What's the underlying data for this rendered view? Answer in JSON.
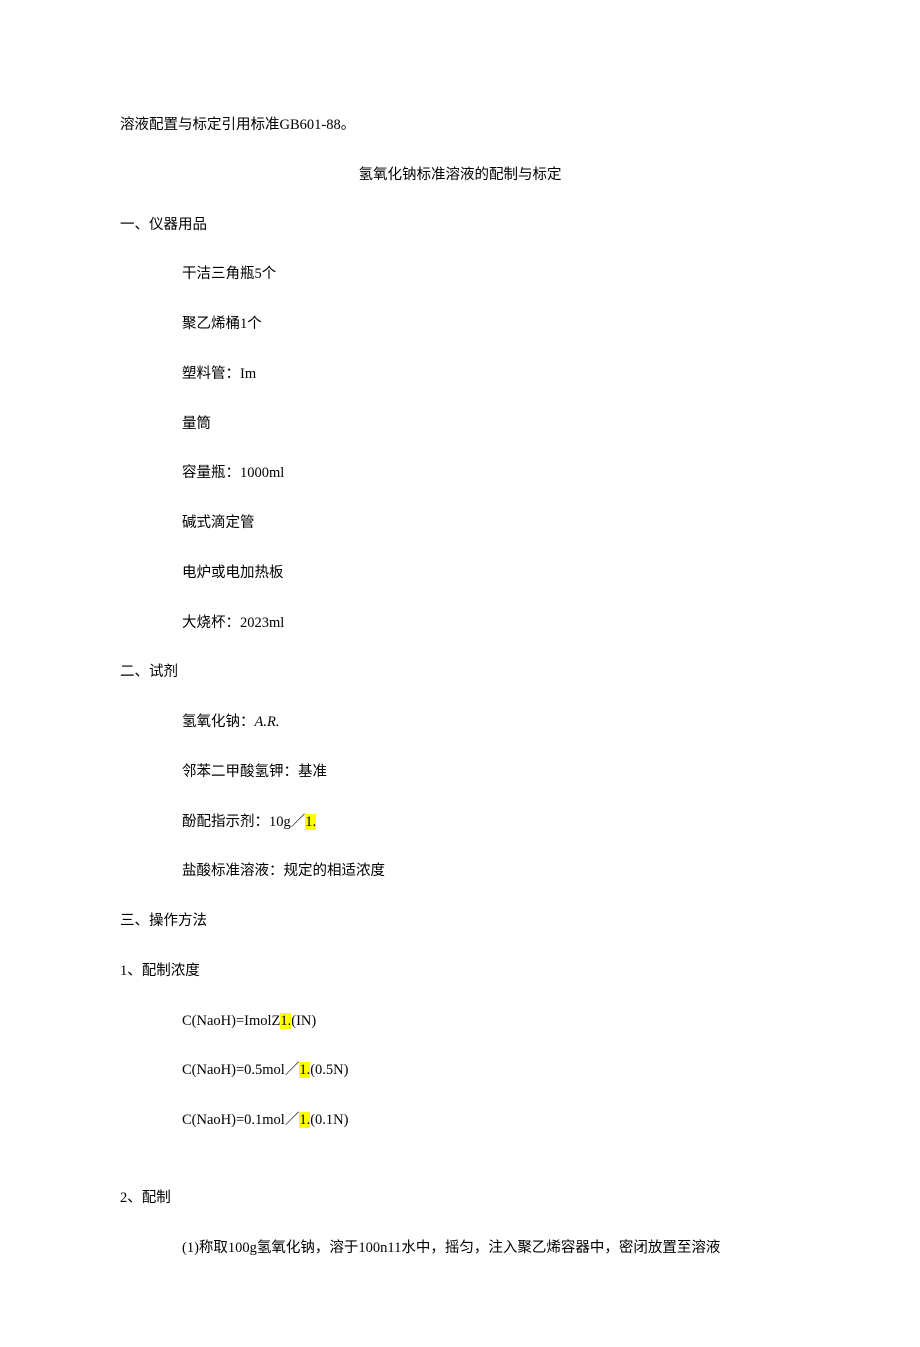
{
  "intro": "溶液配置与标定引用标准GB601-88。",
  "title": "氢氧化钠标准溶液的配制与标定",
  "sec1": {
    "heading": "一、仪器用品",
    "items": [
      "干洁三角瓶5个",
      "聚乙烯桶1个",
      "塑料管：Im",
      "量筒",
      "容量瓶：1000ml",
      "碱式滴定管",
      "电炉或电加热板",
      "大烧杯：2023ml"
    ]
  },
  "sec2": {
    "heading": "二、试剂",
    "item1_a": "氢氧化钠：",
    "item1_b": "A.R.",
    "item2": "邻苯二甲酸氢钾：基准",
    "item3_a": "酚配指示剂：10g／",
    "item3_hl": "1.",
    "item4": "盐酸标准溶液：规定的相适浓度"
  },
  "sec3": {
    "heading": "三、操作方法",
    "sub1": {
      "heading": "1、配制浓度",
      "f1_a": "C(NaoH)=ImolZ",
      "f1_hl": "1.",
      "f1_b": "(IN)",
      "f2_a": "C(NaoH)=0.5mol／",
      "f2_hl": "1.",
      "f2_b": "(0.5N)",
      "f3_a": "C(NaoH)=0.1mol／",
      "f3_hl": "1.",
      "f3_b": "(0.1N)"
    },
    "sub2": {
      "heading": "2、配制",
      "p1": "(1)称取100g氢氧化钠，溶于100n11水中，摇匀，注入聚乙烯容器中，密闭放置至溶液"
    }
  }
}
